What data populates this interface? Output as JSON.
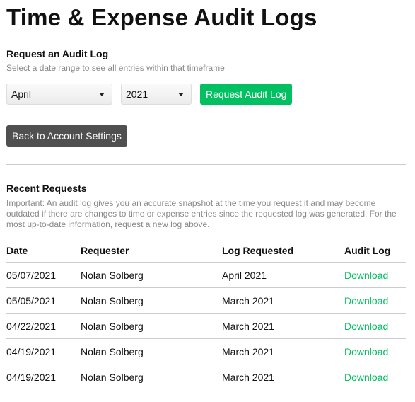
{
  "title": "Time & Expense Audit Logs",
  "request": {
    "heading": "Request an Audit Log",
    "subtitle": "Select a date range to see all entries within that timeframe",
    "month": "April",
    "year": "2021",
    "request_button": "Request Audit Log",
    "back_button": "Back to Account Settings"
  },
  "recent": {
    "heading": "Recent Requests",
    "note": "Important: An audit log gives you an accurate snapshot at the time you request it and may become outdated if there are changes to time or expense entries since the requested log was generated. For the most up-to-date information, request a new log above.",
    "columns": [
      "Date",
      "Requester",
      "Log Requested",
      "Audit Log"
    ],
    "rows": [
      {
        "date": "05/07/2021",
        "requester": "Nolan Solberg",
        "log": "April 2021",
        "link": "Download"
      },
      {
        "date": "05/05/2021",
        "requester": "Nolan Solberg",
        "log": "March 2021",
        "link": "Download"
      },
      {
        "date": "04/22/2021",
        "requester": "Nolan Solberg",
        "log": "March 2021",
        "link": "Download"
      },
      {
        "date": "04/19/2021",
        "requester": "Nolan Solberg",
        "log": "March 2021",
        "link": "Download"
      },
      {
        "date": "04/19/2021",
        "requester": "Nolan Solberg",
        "log": "March 2021",
        "link": "Download"
      }
    ]
  },
  "colors": {
    "accent": "#00c061",
    "dark_button": "#505050"
  }
}
